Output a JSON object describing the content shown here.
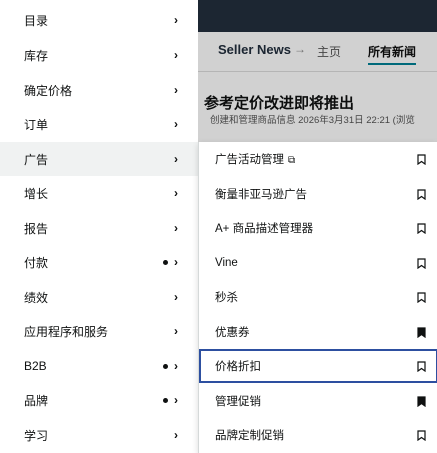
{
  "background": {
    "brand": "Seller News",
    "arrow": "→",
    "home": "主页",
    "all_news": "所有新闻",
    "headline": "参考定价改进即将推出",
    "meta": "创建和管理商品信息   2026年3月31日   22:21 (浏览"
  },
  "left_menu": {
    "items": [
      {
        "label": "目录",
        "chevron": "›"
      },
      {
        "label": "库存",
        "chevron": "›"
      },
      {
        "label": "确定价格",
        "chevron": "›"
      },
      {
        "label": "订单",
        "chevron": "›"
      },
      {
        "label": "广告",
        "chevron": "›"
      },
      {
        "label": "增长",
        "chevron": "›"
      },
      {
        "label": "报告",
        "chevron": "›"
      },
      {
        "label": "付款",
        "chevron": "›"
      },
      {
        "label": "绩效",
        "chevron": "›"
      },
      {
        "label": "应用程序和服务",
        "chevron": "›"
      },
      {
        "label": "B2B",
        "chevron": "›"
      },
      {
        "label": "品牌",
        "chevron": "›"
      },
      {
        "label": "学习",
        "chevron": "›"
      }
    ]
  },
  "submenu": {
    "items": [
      {
        "label": "广告活动管理",
        "ext": "⧉",
        "bookmarked": false
      },
      {
        "label": "衡量非亚马逊广告",
        "bookmarked": false
      },
      {
        "label": "A+ 商品描述管理器",
        "bookmarked": false
      },
      {
        "label": "Vine",
        "bookmarked": false
      },
      {
        "label": "秒杀",
        "bookmarked": false
      },
      {
        "label": "优惠券",
        "bookmarked": true
      },
      {
        "label": "价格折扣",
        "bookmarked": false
      },
      {
        "label": "管理促销",
        "bookmarked": true
      },
      {
        "label": "品牌定制促销",
        "bookmarked": false
      }
    ]
  },
  "colors": {
    "accent": "#2d4fa0",
    "topbar": "#232f3e"
  }
}
